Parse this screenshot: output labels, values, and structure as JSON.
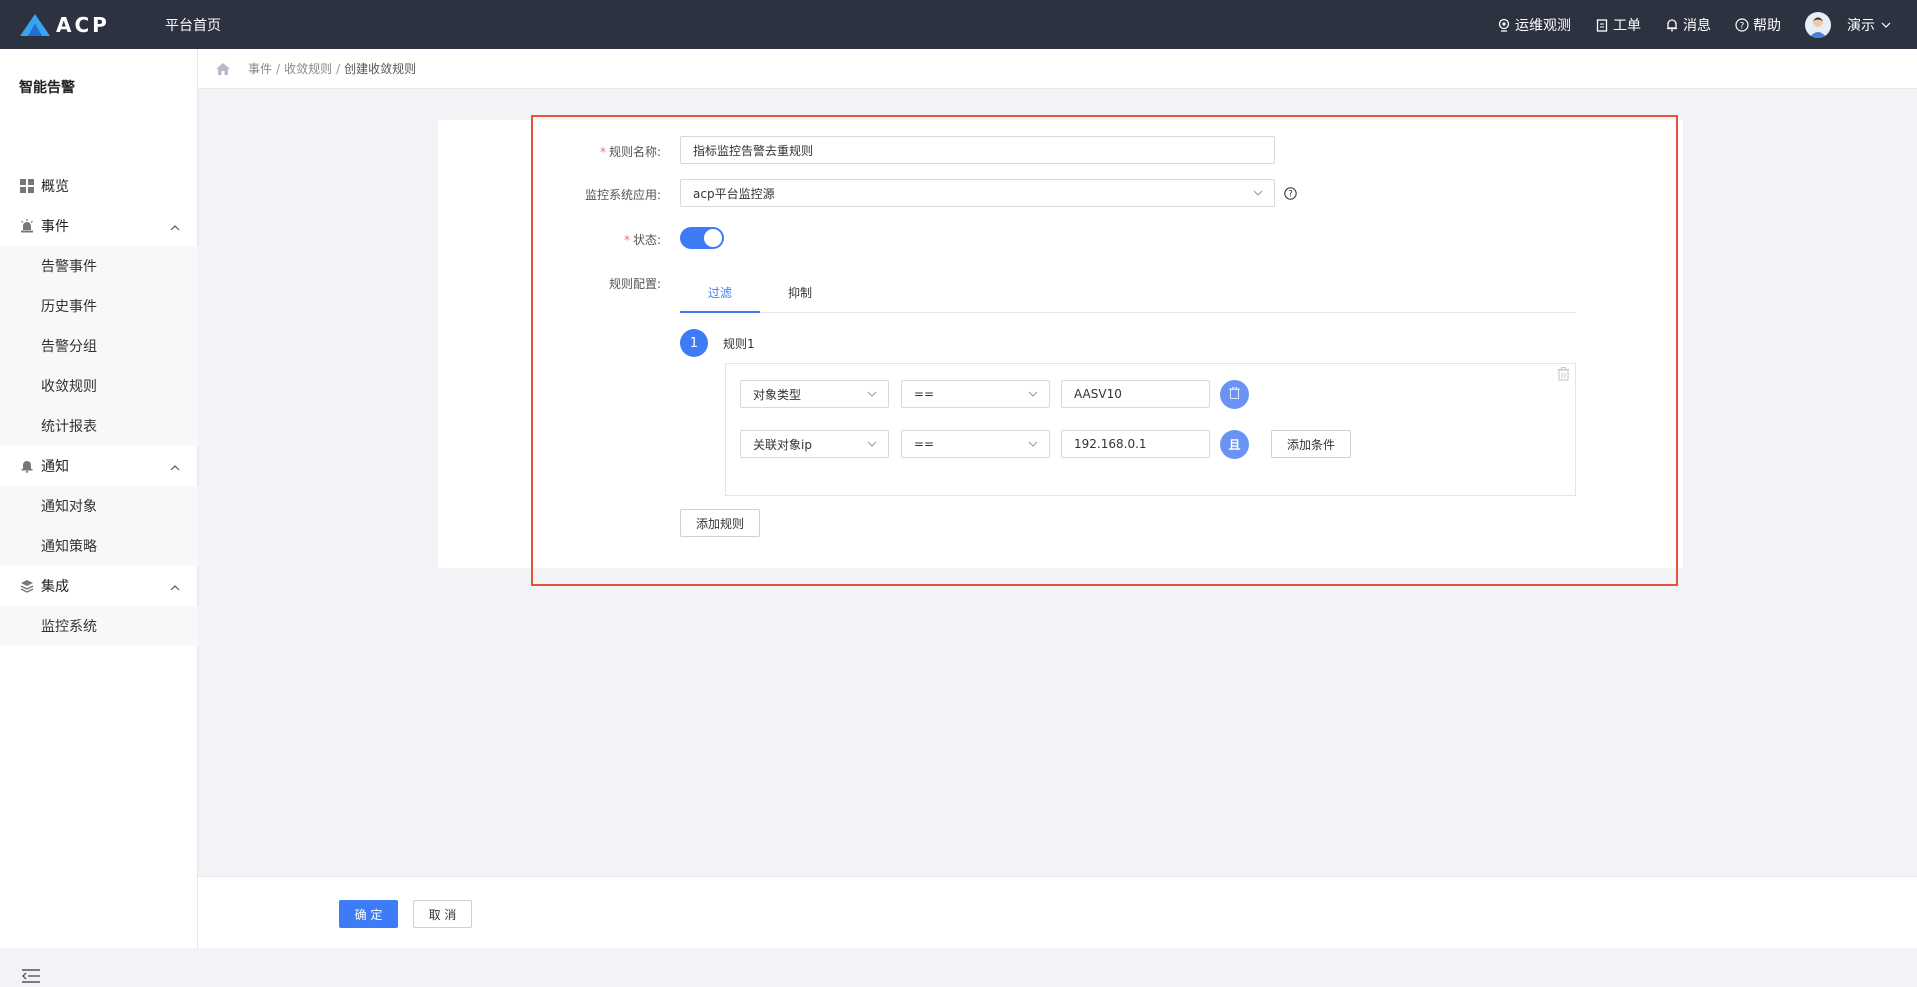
{
  "topbar": {
    "logo_text": "ACP",
    "home": "平台首页",
    "items": [
      {
        "label": "运维观测",
        "icon": "monitor-icon"
      },
      {
        "label": "工单",
        "icon": "clipboard-icon"
      },
      {
        "label": "消息",
        "icon": "bell-icon"
      },
      {
        "label": "帮助",
        "icon": "help-icon"
      }
    ],
    "user": "演示"
  },
  "sidebar": {
    "title": "智能告警",
    "overview": "概览",
    "groups": [
      {
        "label": "事件",
        "items": [
          "告警事件",
          "历史事件",
          "告警分组",
          "收敛规则",
          "统计报表"
        ]
      },
      {
        "label": "通知",
        "items": [
          "通知对象",
          "通知策略"
        ]
      },
      {
        "label": "集成",
        "items": [
          "监控系统"
        ]
      }
    ]
  },
  "breadcrumb": {
    "items": [
      "事件",
      "收敛规则"
    ],
    "current": "创建收敛规则"
  },
  "form": {
    "name_label": "规则名称:",
    "name_value": "指标监控告警去重规则",
    "app_label": "监控系统应用:",
    "app_value": "acp平台监控源",
    "status_label": "状态:",
    "config_label": "规则配置:",
    "tabs": [
      "过滤",
      "抑制"
    ],
    "rule_number": "1",
    "rule_title": "规则1",
    "conditions": [
      {
        "field": "对象类型",
        "op": "==",
        "value": "AASV10"
      },
      {
        "field": "关联对象ip",
        "op": "==",
        "value": "192.168.0.1"
      }
    ],
    "and_label": "且",
    "add_condition": "添加条件",
    "add_rule": "添加规则"
  },
  "footer": {
    "confirm": "确 定",
    "cancel": "取 消"
  }
}
